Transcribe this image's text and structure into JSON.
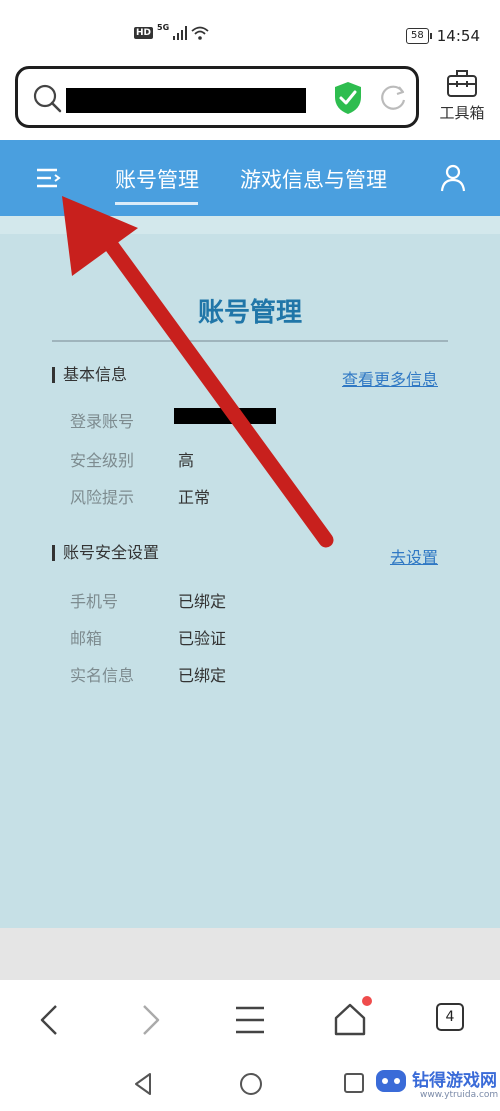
{
  "status_bar": {
    "hd": "HD",
    "network": "5G",
    "battery": "58",
    "time": "14:54"
  },
  "address_bar": {
    "url": ""
  },
  "toolbox": {
    "label": "工具箱"
  },
  "site_nav": {
    "tabs": [
      {
        "label": "账号管理",
        "active": true
      },
      {
        "label": "游戏信息与管理",
        "active": false
      }
    ]
  },
  "page": {
    "title": "账号管理",
    "sections": [
      {
        "title": "基本信息",
        "link": "查看更多信息",
        "rows": [
          {
            "label": "登录账号",
            "value": ""
          },
          {
            "label": "安全级别",
            "value": "高"
          },
          {
            "label": "风险提示",
            "value": "正常"
          }
        ]
      },
      {
        "title": "账号安全设置",
        "link": "去设置",
        "rows": [
          {
            "label": "手机号",
            "value": "已绑定"
          },
          {
            "label": "邮箱",
            "value": "已验证"
          },
          {
            "label": "实名信息",
            "value": "已绑定"
          }
        ]
      }
    ]
  },
  "bottom_nav": {
    "tab_count": "4"
  },
  "watermark": {
    "name": "钻得游戏网",
    "url": "www.ytruida.com"
  },
  "colors": {
    "nav_blue": "#4a9fdf",
    "content_bg": "#c6e0e6",
    "title_blue": "#2076a8",
    "link_blue": "#2f78c4",
    "arrow_red": "#c8201d",
    "shield_green": "#2ebd4f"
  }
}
